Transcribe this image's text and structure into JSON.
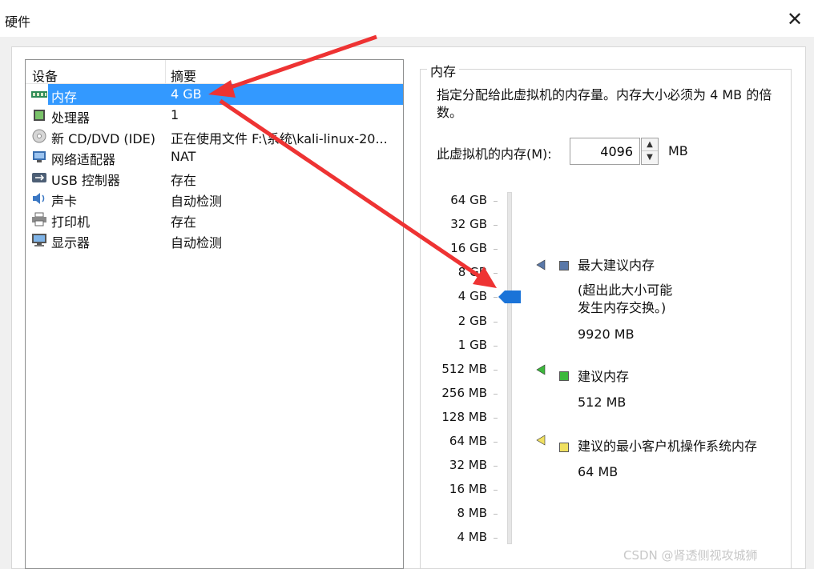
{
  "window": {
    "title": "硬件",
    "close_glyph": "✕"
  },
  "device_list": {
    "columns": [
      "设备",
      "摘要"
    ],
    "rows": [
      {
        "name": "内存",
        "summary": "4 GB",
        "icon": "memory-icon"
      },
      {
        "name": "处理器",
        "summary": "1",
        "icon": "processor-icon"
      },
      {
        "name": "新 CD/DVD (IDE)",
        "summary": "正在使用文件 F:\\系统\\kali-linux-20...",
        "icon": "cd-dvd-icon"
      },
      {
        "name": "网络适配器",
        "summary": "NAT",
        "icon": "network-adapter-icon"
      },
      {
        "name": "USB 控制器",
        "summary": "存在",
        "icon": "usb-icon"
      },
      {
        "name": "声卡",
        "summary": "自动检测",
        "icon": "speaker-icon"
      },
      {
        "name": "打印机",
        "summary": "存在",
        "icon": "printer-icon"
      },
      {
        "name": "显示器",
        "summary": "自动检测",
        "icon": "monitor-icon"
      }
    ],
    "selected_index": 0
  },
  "memory": {
    "group_title": "内存",
    "description": "指定分配给此虚拟机的内存量。内存大小必须为 4 MB 的倍数。",
    "field_label": "此虚拟机的内存(M):",
    "value": "4096",
    "unit": "MB",
    "scale_labels": [
      "64 GB",
      "32 GB",
      "16 GB",
      "8 GB",
      "4 GB",
      "2 GB",
      "1 GB",
      "512 MB",
      "256 MB",
      "128 MB",
      "64 MB",
      "32 MB",
      "16 MB",
      "8 MB",
      "4 MB"
    ],
    "slider_value": "4 GB",
    "legend": [
      {
        "title": "最大建议内存",
        "note": [
          "(超出此大小可能",
          "发生内存交换。)"
        ],
        "value": "9920 MB",
        "color": "#5a78a8"
      },
      {
        "title": "建议内存",
        "note": [],
        "value": "512 MB",
        "color": "#3cb83c"
      },
      {
        "title": "建议的最小客户机操作系统内存",
        "note": [],
        "value": "64 MB",
        "color": "#f0e060"
      }
    ]
  },
  "watermark": "CSDN @肾透侧视攻城狮",
  "colors": {
    "selection": "#3399ff",
    "annotation_arrow": "#ee3333",
    "slider_thumb": "#1a73d8"
  }
}
